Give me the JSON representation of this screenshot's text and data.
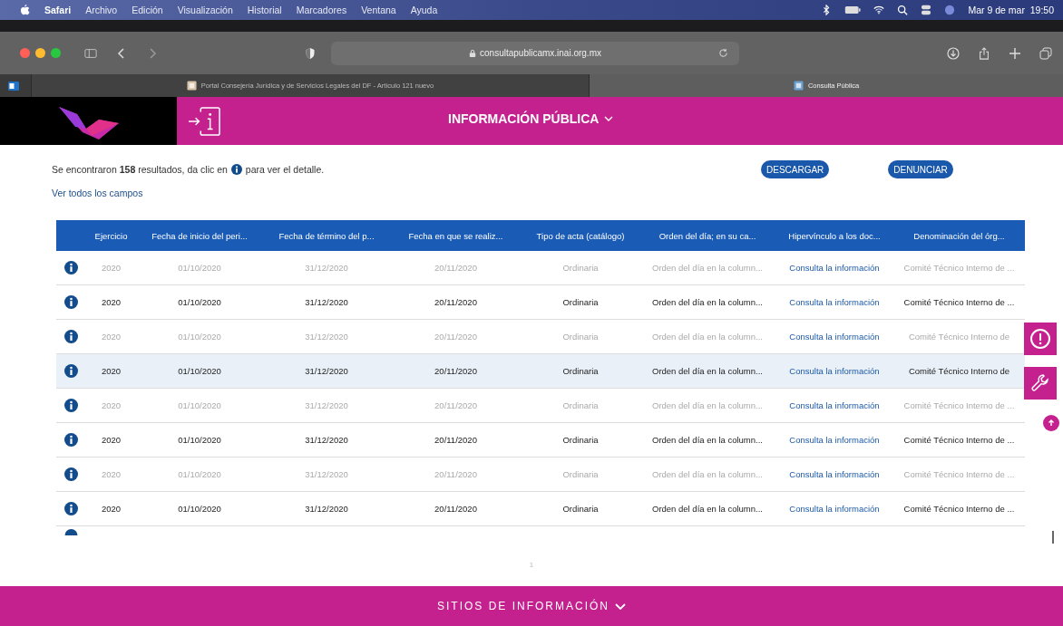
{
  "menubar": {
    "app": "Safari",
    "menus": [
      "Archivo",
      "Edición",
      "Visualización",
      "Historial",
      "Marcadores",
      "Ventana",
      "Ayuda"
    ],
    "clock": "Mar 9 de mar  19:50"
  },
  "browser": {
    "url": "consultapublicamx.inai.org.mx",
    "tabs": [
      {
        "title": "Portal Consejería Jurídica y de Servicios Legales del DF - Artículo 121 nuevo",
        "selected": false
      },
      {
        "title": "Consulta Pública",
        "selected": true
      }
    ]
  },
  "header": {
    "title": "INFORMACIÓN PÚBLICA"
  },
  "results": {
    "text_before": "Se encontraron **158** resultados, da clic en",
    "text_after": "para ver el detalle.",
    "link": "Ver todos los campos",
    "buttons": [
      "DESCARGAR",
      "DENUNCIAR"
    ]
  },
  "table": {
    "columns": [
      {
        "label": "Ejercicio",
        "kind": "text"
      },
      {
        "label": "Fecha de inicio del peri...",
        "kind": "text"
      },
      {
        "label": "Fecha de término del p...",
        "kind": "text"
      },
      {
        "label": "Fecha en que se realiz...",
        "kind": "text"
      },
      {
        "label": "Tipo de acta (catálogo)",
        "kind": "text"
      },
      {
        "label": "Orden del día; en su ca...",
        "kind": "text"
      },
      {
        "label": "Hipervínculo a los doc...",
        "kind": "link"
      },
      {
        "label": "Denominación del órg...",
        "kind": "text"
      }
    ],
    "rows": [
      {
        "cells": [
          "2020",
          "01/10/2020",
          "31/12/2020",
          "20/11/2020",
          "Ordinaria",
          "Orden del día en la column...",
          "Consulta la información",
          "Comité Técnico Interno de ..."
        ],
        "dimmed": true,
        "selected": false
      },
      {
        "cells": [
          "2020",
          "01/10/2020",
          "31/12/2020",
          "20/11/2020",
          "Ordinaria",
          "Orden del día en la column...",
          "Consulta la información",
          "Comité Técnico Interno de ..."
        ],
        "dimmed": false,
        "selected": false
      },
      {
        "cells": [
          "2020",
          "01/10/2020",
          "31/12/2020",
          "20/11/2020",
          "Ordinaria",
          "Orden del día en la column...",
          "Consulta la información",
          "Comité Técnico Interno de"
        ],
        "dimmed": true,
        "selected": false
      },
      {
        "cells": [
          "2020",
          "01/10/2020",
          "31/12/2020",
          "20/11/2020",
          "Ordinaria",
          "Orden del día en la column...",
          "Consulta la información",
          "Comité Técnico Interno de"
        ],
        "dimmed": false,
        "selected": true
      },
      {
        "cells": [
          "2020",
          "01/10/2020",
          "31/12/2020",
          "20/11/2020",
          "Ordinaria",
          "Orden del día en la column...",
          "Consulta la información",
          "Comité Técnico Interno de ..."
        ],
        "dimmed": true,
        "selected": false
      },
      {
        "cells": [
          "2020",
          "01/10/2020",
          "31/12/2020",
          "20/11/2020",
          "Ordinaria",
          "Orden del día en la column...",
          "Consulta la información",
          "Comité Técnico Interno de ..."
        ],
        "dimmed": false,
        "selected": false
      },
      {
        "cells": [
          "2020",
          "01/10/2020",
          "31/12/2020",
          "20/11/2020",
          "Ordinaria",
          "Orden del día en la column...",
          "Consulta la información",
          "Comité Técnico Interno de ..."
        ],
        "dimmed": true,
        "selected": false
      },
      {
        "cells": [
          "2020",
          "01/10/2020",
          "31/12/2020",
          "20/11/2020",
          "Ordinaria",
          "Orden del día en la column...",
          "Consulta la información",
          "Comité Técnico Interno de ..."
        ],
        "dimmed": false,
        "selected": false
      }
    ]
  },
  "pagination": {
    "page": "1"
  },
  "footer": {
    "title": "SITIOS DE INFORMACIÓN"
  }
}
